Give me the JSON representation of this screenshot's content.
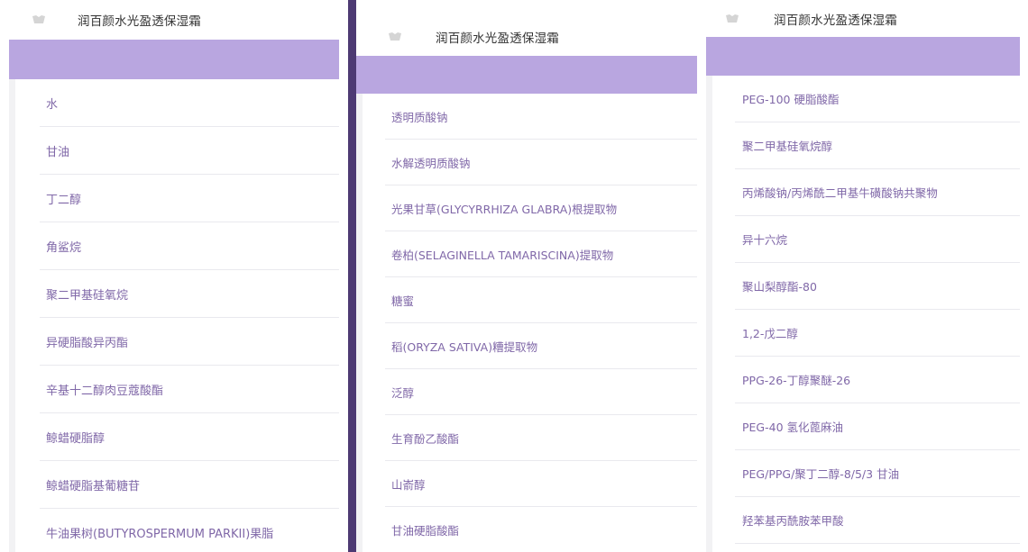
{
  "panels": [
    {
      "logo_icon": "product-logo-icon",
      "title": "润百颜水光盈透保湿霜",
      "items": [
        "水",
        "甘油",
        "丁二醇",
        "角鲨烷",
        "聚二甲基硅氧烷",
        "异硬脂酸异丙酯",
        "辛基十二醇肉豆蔻酸酯",
        "鲸蜡硬脂醇",
        "鲸蜡硬脂基葡糖苷",
        "牛油果树(BUTYROSPERMUM PARKII)果脂"
      ]
    },
    {
      "logo_icon": "product-logo-icon",
      "title": "润百颜水光盈透保湿霜",
      "items": [
        "透明质酸钠",
        "水解透明质酸钠",
        "光果甘草(GLYCYRRHIZA GLABRA)根提取物",
        "卷柏(SELAGINELLA TAMARISCINA)提取物",
        "糖蜜",
        "稻(ORYZA SATIVA)糟提取物",
        "泛醇",
        "生育酚乙酸酯",
        "山嵛醇",
        "甘油硬脂酸酯"
      ]
    },
    {
      "logo_icon": "product-logo-icon",
      "title": "润百颜水光盈透保湿霜",
      "items": [
        "PEG-100 硬脂酸酯",
        "聚二甲基硅氧烷醇",
        "丙烯酸钠/丙烯酰二甲基牛磺酸钠共聚物",
        "异十六烷",
        "聚山梨醇酯-80",
        "1,2-戊二醇",
        "PPG-26-丁醇聚醚-26",
        "PEG-40 氢化蓖麻油",
        "PEG/PPG/聚丁二醇-8/5/3 甘油",
        "羟苯基丙酰胺苯甲酸"
      ]
    }
  ],
  "colors": {
    "band": "#b9a6e0",
    "item_text": "#8068a8",
    "divider": "#4d3a73",
    "row_border": "#e9e9ee"
  }
}
